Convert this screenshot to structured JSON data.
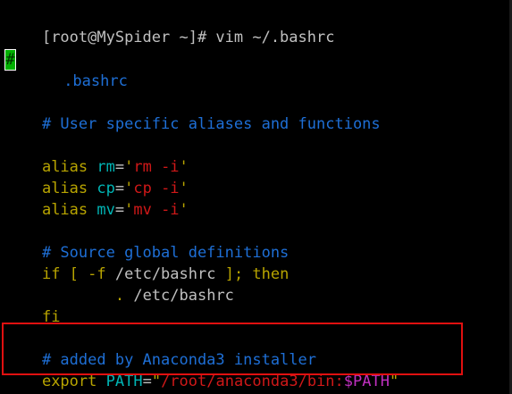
{
  "prompt": {
    "text": "[root@MySpider ~]# vim ~/.bashrc"
  },
  "file": {
    "cursor_char": "#",
    "header_comment": " .bashrc",
    "comment_aliases": "# User specific aliases and functions",
    "aliases": [
      {
        "keyword": "alias ",
        "name": "rm",
        "eq": "=",
        "q1": "'",
        "value": "rm -i",
        "q2": "'"
      },
      {
        "keyword": "alias ",
        "name": "cp",
        "eq": "=",
        "q1": "'",
        "value": "cp -i",
        "q2": "'"
      },
      {
        "keyword": "alias ",
        "name": "mv",
        "eq": "=",
        "q1": "'",
        "value": "mv -i",
        "q2": "'"
      }
    ],
    "comment_source": "# Source global definitions",
    "if_line": {
      "kw_if": "if",
      "bracket_open": " [ ",
      "flag": "-f",
      "path": " /etc/bashrc ",
      "bracket_close": "];",
      "kw_then": " then"
    },
    "source_line": {
      "indent": "        ",
      "dot": ".",
      "path": " /etc/bashrc"
    },
    "fi_line": "fi",
    "comment_anaconda": "# added by Anaconda3 installer",
    "export_line": {
      "kw_export": "export ",
      "var": "PATH",
      "eq": "=",
      "quote_open": "\"",
      "path": "/root/anaconda3/bin:",
      "dollar_var": "$PATH",
      "quote_close": "\""
    },
    "tilde": "~"
  },
  "colors": {
    "background": "#000000",
    "text": "#c0c0c0",
    "comment": "#1e6fd6",
    "keyword": "#b8a400",
    "identifier": "#00b4b4",
    "string": "#d01818",
    "variable": "#c030c0",
    "highlight_border": "#e01010",
    "cursor": "#00b000"
  }
}
